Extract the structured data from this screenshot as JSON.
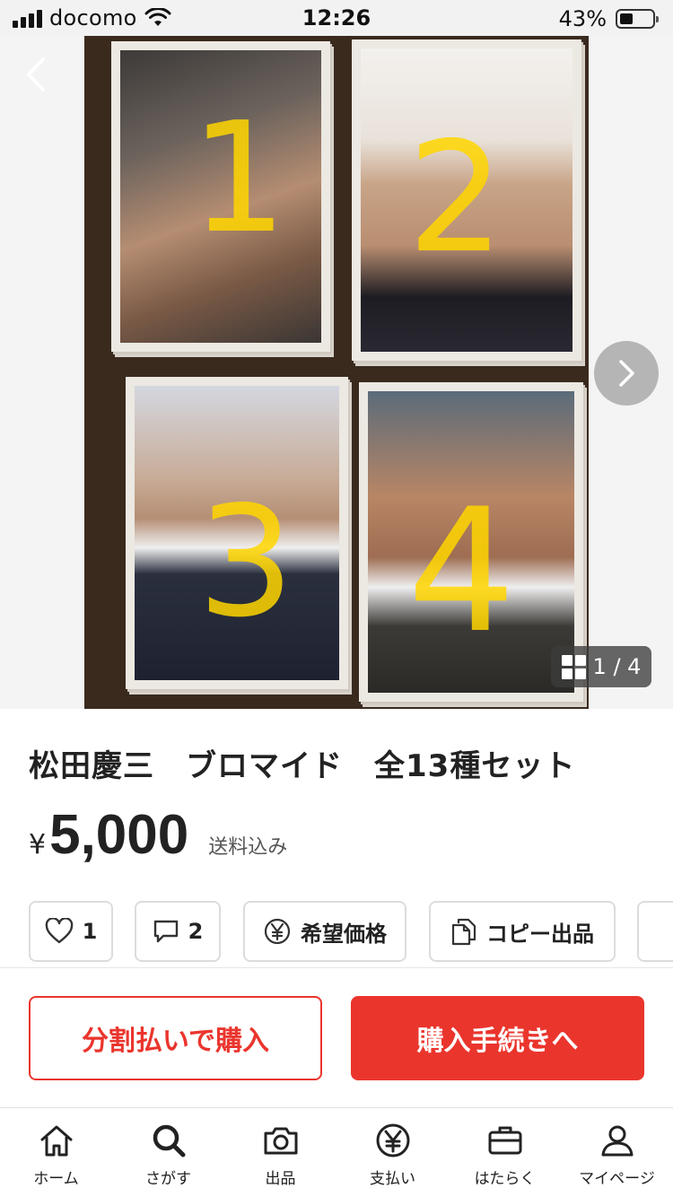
{
  "status_bar": {
    "carrier": "docomo",
    "time": "12:26",
    "battery": "43%"
  },
  "gallery": {
    "counter": "1 / 4",
    "numerals": [
      "1",
      "2",
      "3",
      "4"
    ]
  },
  "product": {
    "title": "松田慶三　ブロマイド　全13種セット",
    "currency": "¥",
    "price": "5,000",
    "shipping": "送料込み"
  },
  "actions": {
    "like_count": "1",
    "comment_count": "2",
    "offer_label": "希望価格",
    "copy_label": "コピー出品"
  },
  "purchase": {
    "split_label": "分割払いで購入",
    "buy_label": "購入手続きへ"
  },
  "tabs": [
    {
      "label": "ホーム",
      "icon": "home-icon"
    },
    {
      "label": "さがす",
      "icon": "search-icon"
    },
    {
      "label": "出品",
      "icon": "camera-icon"
    },
    {
      "label": "支払い",
      "icon": "yen-icon"
    },
    {
      "label": "はたらく",
      "icon": "briefcase-icon"
    },
    {
      "label": "マイページ",
      "icon": "person-icon"
    }
  ],
  "colors": {
    "accent": "#ea352d",
    "numeral": "#ffd600"
  }
}
